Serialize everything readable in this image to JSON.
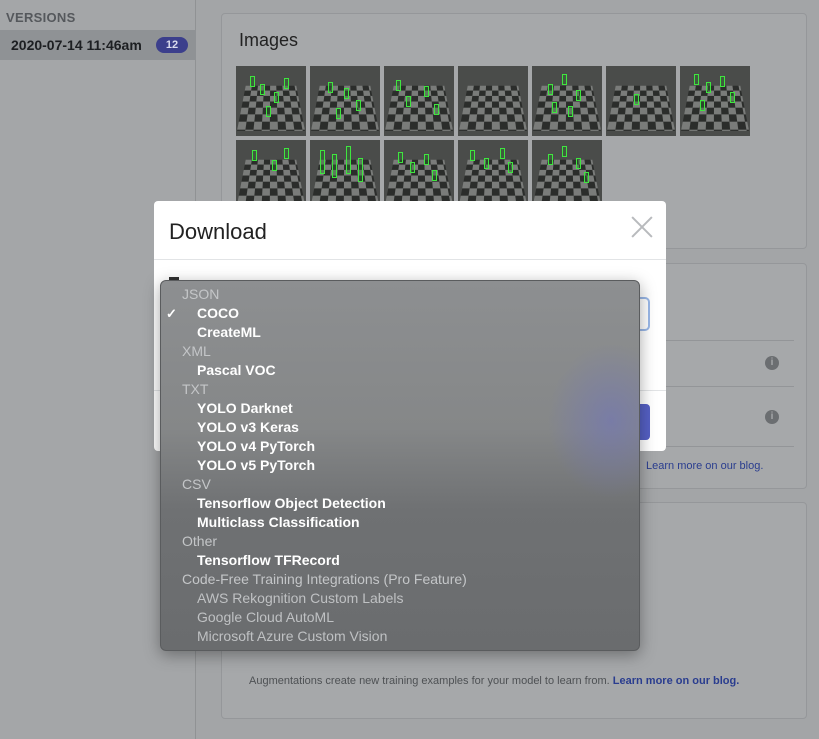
{
  "sidebar": {
    "header": "VERSIONS",
    "version_label": "2020-07-14 11:46am",
    "version_badge": "12"
  },
  "images_card": {
    "title": "Images"
  },
  "mid_card": {
    "learn_more": "Learn more on our blog."
  },
  "augment_card": {
    "description": "Augmentations create new training examples for your model to learn from.",
    "learn_more": "Learn more on our blog."
  },
  "modal": {
    "title": "Download",
    "close_icon": "close-icon"
  },
  "format_menu": {
    "selected": "COCO",
    "groups": [
      {
        "label": "JSON",
        "options": [
          {
            "label": "COCO",
            "selected": true
          },
          {
            "label": "CreateML"
          }
        ]
      },
      {
        "label": "XML",
        "options": [
          {
            "label": "Pascal VOC"
          }
        ]
      },
      {
        "label": "TXT",
        "options": [
          {
            "label": "YOLO Darknet"
          },
          {
            "label": "YOLO v3 Keras"
          },
          {
            "label": "YOLO v4 PyTorch"
          },
          {
            "label": "YOLO v5 PyTorch"
          }
        ]
      },
      {
        "label": "CSV",
        "options": [
          {
            "label": "Tensorflow Object Detection"
          },
          {
            "label": "Multiclass Classification"
          }
        ]
      },
      {
        "label": "Other",
        "options": [
          {
            "label": "Tensorflow TFRecord"
          }
        ]
      },
      {
        "label": "Code-Free Training Integrations (Pro Feature)",
        "options": [
          {
            "label": "AWS Rekognition Custom Labels",
            "disabled": true
          },
          {
            "label": "Google Cloud AutoML",
            "disabled": true
          },
          {
            "label": "Microsoft Azure Custom Vision",
            "disabled": true
          }
        ]
      }
    ]
  },
  "colors": {
    "accent": "#5560c4",
    "link": "#2a3d8f",
    "bounding_box": "#3fe63f"
  }
}
